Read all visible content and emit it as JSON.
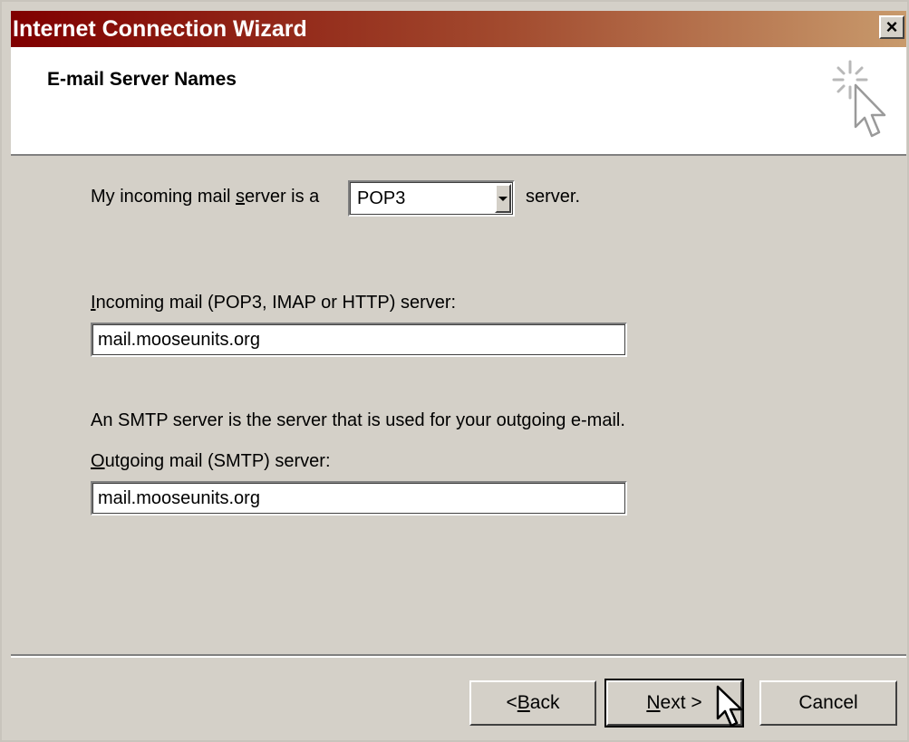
{
  "window": {
    "title": "Internet Connection Wizard",
    "close_symbol": "×"
  },
  "header": {
    "title": "E-mail Server Names",
    "icon": "wizard-cursor-icon"
  },
  "incoming_type": {
    "prefix_before": "My incoming mail ",
    "prefix_underline": "s",
    "prefix_after": "erver is a",
    "selected": "POP3",
    "suffix": "server."
  },
  "incoming_server": {
    "label_underline": "I",
    "label_rest": "ncoming mail (POP3, IMAP or HTTP) server:",
    "value": "mail.mooseunits.org"
  },
  "smtp_note": "An SMTP server is the server that is used for your outgoing e-mail.",
  "outgoing_server": {
    "label_underline": "O",
    "label_rest": "utgoing mail (SMTP) server:",
    "value": "mail.mooseunits.org"
  },
  "buttons": {
    "back_prefix": "< ",
    "back_underline": "B",
    "back_rest": "ack",
    "next_underline": "N",
    "next_rest": "ext >",
    "cancel": "Cancel"
  },
  "colors": {
    "face": "#d4d0c8",
    "title_start": "#800000",
    "title_end": "#c89a6c"
  }
}
